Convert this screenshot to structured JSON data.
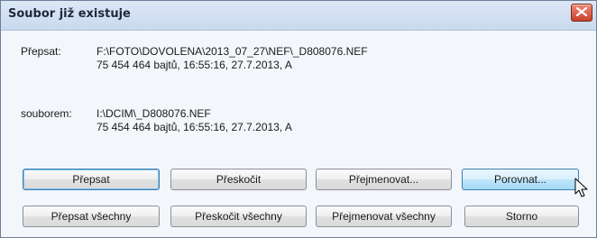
{
  "window": {
    "title": "Soubor již existuje"
  },
  "overwrite": {
    "label": "Přepsat:",
    "path": "F:\\FOTO\\DOVOLENA\\2013_07_27\\NEF\\_D808076.NEF",
    "details": "75 454 464 bajtů, 16:55:16, 27.7.2013, A"
  },
  "source": {
    "label": "souborem:",
    "path": "I:\\DCIM\\_D808076.NEF",
    "details": "75 454 464 bajtů, 16:55:16, 27.7.2013, A"
  },
  "buttons": {
    "overwrite": "Přepsat",
    "skip": "Přeskočit",
    "rename": "Přejmenovat...",
    "compare": "Porovnat...",
    "overwrite_all": "Přepsat všechny",
    "skip_all": "Přeskočit všechny",
    "rename_all": "Přejmenovat všechny",
    "cancel": "Storno"
  },
  "icons": {
    "close": "close-icon",
    "cursor": "mouse-pointer-icon"
  },
  "colors": {
    "close_button": "#c8402c",
    "hover_button": "#bee6fd",
    "default_border": "#3c7fb1"
  }
}
